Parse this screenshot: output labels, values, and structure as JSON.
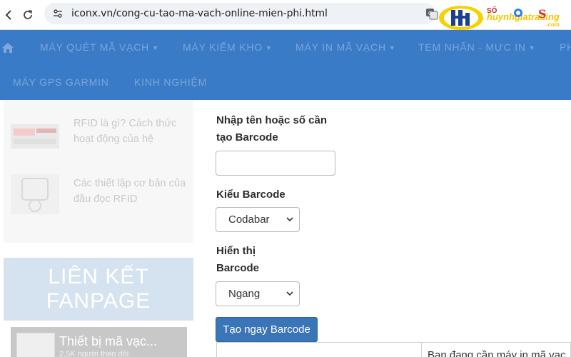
{
  "browser": {
    "url": "iconx.vn/cong-cu-tao-ma-vach-online-mien-phi.html",
    "brand_name": "huynhgiatrading",
    "brand_domain": ".com",
    "ext_so_label": "SỐ",
    "ext_s_label": "S"
  },
  "nav": {
    "row1": [
      "MÁY QUÉT MÃ VẠCH",
      "MÁY KIỂM KHO",
      "MÁY IN MÃ VẠCH",
      "TEM NHÃN - MỰC IN",
      "PH"
    ],
    "row2": [
      "MÁY GPS GARMIN",
      "KINH NGHIỆM"
    ]
  },
  "sidebar": {
    "posts": [
      {
        "title": "RFID là gì? Cách thức hoạt động của hệ"
      },
      {
        "title": "Các thiết lập cơ bản của đầu đọc RFID"
      }
    ],
    "fanpage_heading_line1": "LIÊN KẾT",
    "fanpage_heading_line2": "FANPAGE",
    "fb_page_name": "Thiết bị mã vạc...",
    "fb_followers": "2,5K người theo dõi"
  },
  "form": {
    "partial_text": "",
    "input_label_line1": "Nhập tên hoặc số cần",
    "input_label_line2": "tạo Barcode",
    "input_value": "",
    "type_label": "Kiểu Barcode",
    "type_selected": "Codabar",
    "display_label_line1": "Hiển thị",
    "display_label_line2": "Barcode",
    "display_selected": "Ngang",
    "submit_label": "Tạo ngay Barcode",
    "result_message": "Bạn đang cần máy in mã vạc"
  },
  "colors": {
    "nav_blue": "#3a7bc8",
    "button_blue": "#3a75b8",
    "brand_yellow": "#f5c400",
    "fanpage_bg": "#d5e2f0"
  }
}
